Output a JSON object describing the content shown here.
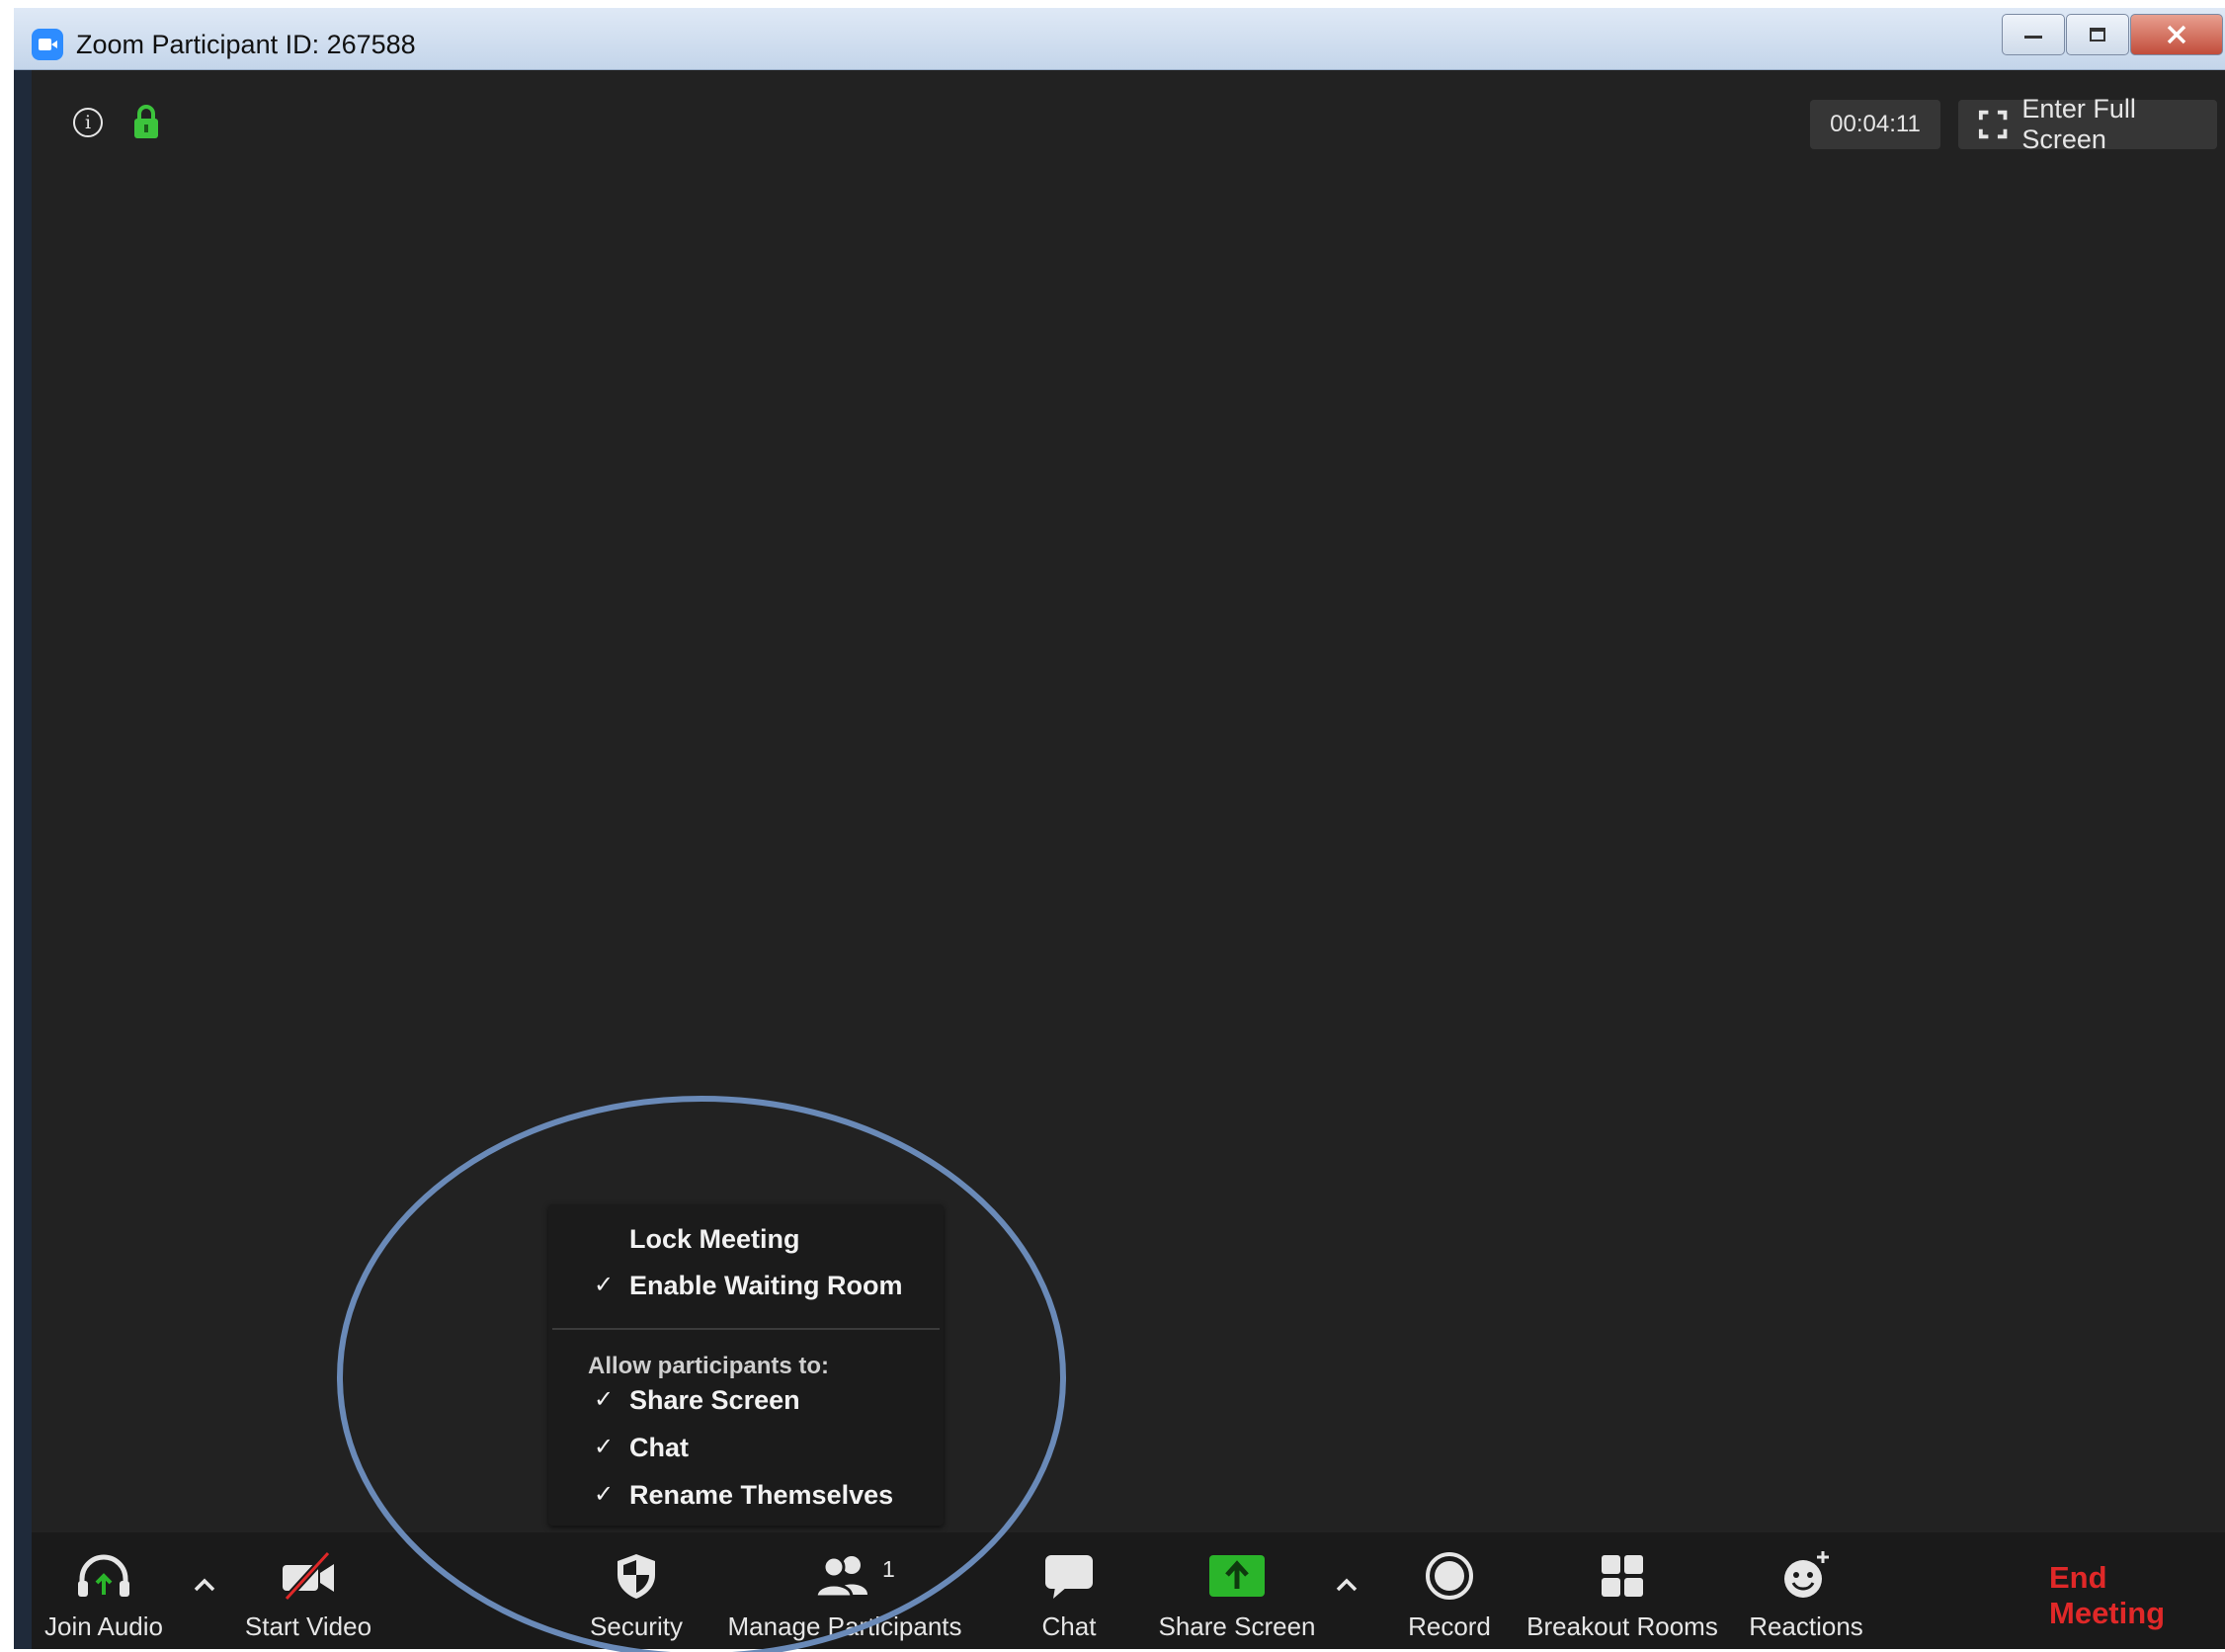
{
  "window": {
    "title": "Zoom Participant ID: 267588"
  },
  "top_bar": {
    "timer": "00:04:11",
    "fullscreen_label": "Enter Full Screen"
  },
  "security_menu": {
    "lock_meeting": "Lock Meeting",
    "waiting_room": "Enable Waiting Room",
    "section_header": "Allow participants to:",
    "share_screen": "Share Screen",
    "chat": "Chat",
    "rename": "Rename Themselves",
    "check": "✓"
  },
  "toolbar": {
    "join_audio": "Join Audio",
    "start_video": "Start Video",
    "security": "Security",
    "manage_participants": "Manage Participants",
    "participant_count": "1",
    "chat": "Chat",
    "share_screen": "Share Screen",
    "record": "Record",
    "breakout_rooms": "Breakout Rooms",
    "reactions": "Reactions",
    "end_meeting": "End Meeting"
  },
  "colors": {
    "accent_green": "#2ab52a",
    "end_red": "#e02828",
    "annotation_blue": "#6a8ab8"
  }
}
